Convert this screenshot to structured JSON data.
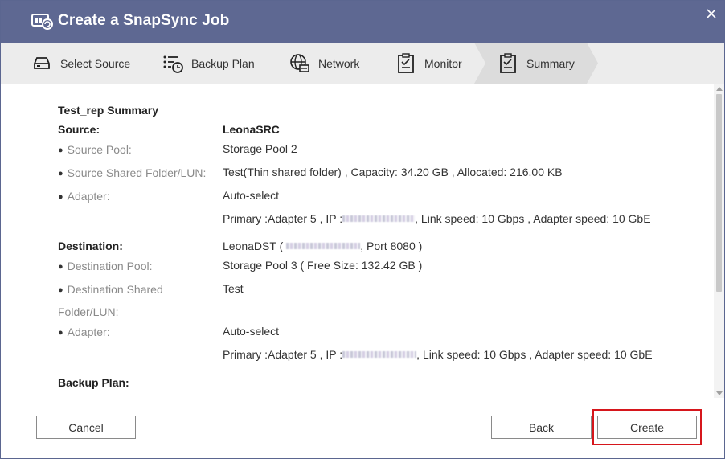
{
  "window": {
    "title": "Create a SnapSync Job"
  },
  "steps": [
    {
      "label": "Select Source",
      "icon": "drive-icon"
    },
    {
      "label": "Backup Plan",
      "icon": "backup-plan-icon"
    },
    {
      "label": "Network",
      "icon": "network-icon"
    },
    {
      "label": "Monitor",
      "icon": "monitor-checklist-icon"
    },
    {
      "label": "Summary",
      "icon": "summary-checklist-icon",
      "active": true
    }
  ],
  "summary": {
    "title": "Test_rep Summary",
    "source": {
      "header": "Source:",
      "name": "LeonaSRC",
      "pool_label": "Source Pool:",
      "pool_value": "Storage Pool 2",
      "folder_label": "Source Shared Folder/LUN:",
      "folder_value": "Test(Thin shared folder) , Capacity: 34.20 GB , Allocated: 216.00 KB",
      "adapter_label": "Adapter:",
      "adapter_value": "Auto-select",
      "primary_prefix": "Primary :Adapter 5 , IP :",
      "primary_suffix": ", Link speed: 10 Gbps , Adapter speed: 10 GbE"
    },
    "destination": {
      "header": "Destination:",
      "name_prefix": "LeonaDST (",
      "name_suffix": ", Port 8080 )",
      "pool_label": "Destination Pool:",
      "pool_value": "Storage Pool 3 ( Free Size: 132.42 GB )",
      "folder_label_1": "Destination Shared",
      "folder_label_2": "Folder/LUN:",
      "folder_value": "Test",
      "adapter_label": "Adapter:",
      "adapter_value": "Auto-select",
      "primary_prefix": "Primary :Adapter 5 , IP :",
      "primary_suffix": ", Link speed: 10 Gbps , Adapter speed: 10 GbE"
    },
    "backup_plan": {
      "header": "Backup Plan:"
    }
  },
  "buttons": {
    "cancel": "Cancel",
    "back": "Back",
    "create": "Create"
  },
  "colors": {
    "titlebar": "#5e6892",
    "highlight": "#d6161c",
    "stepbar": "#ececec",
    "active_step": "#dcdcdc"
  }
}
